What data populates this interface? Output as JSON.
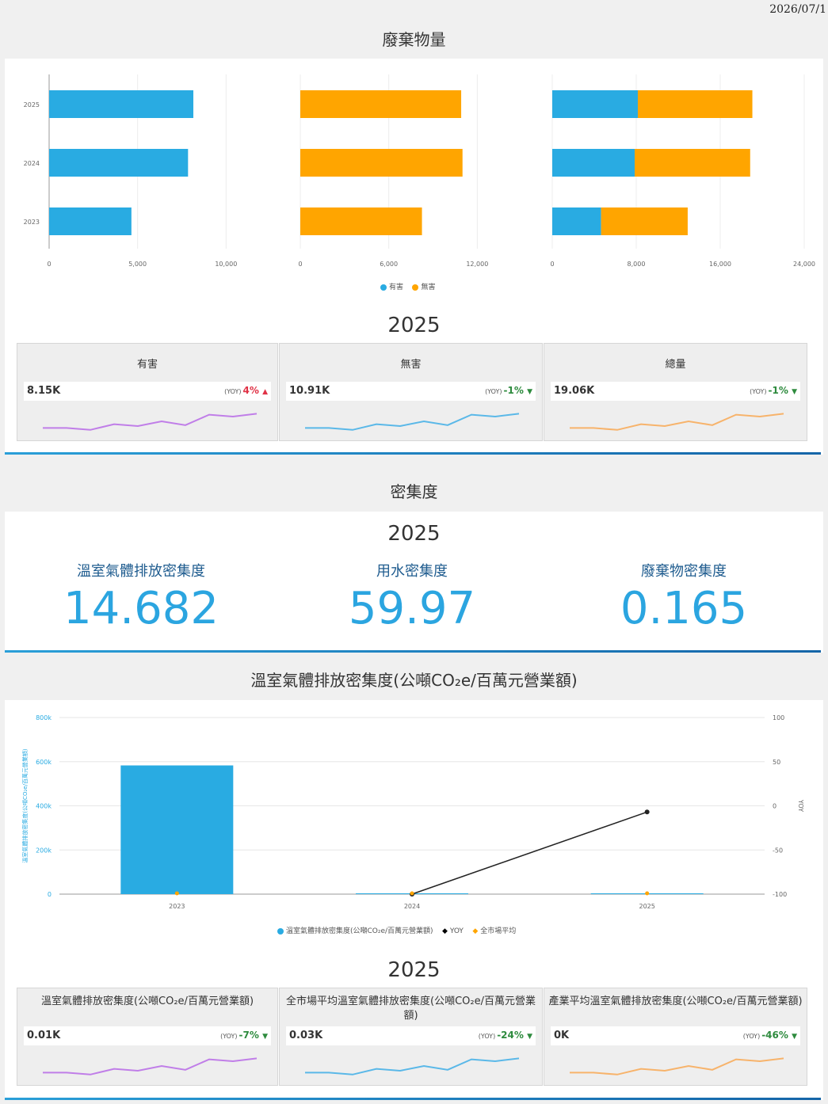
{
  "date": "2026/07/1",
  "waste_section": {
    "title": "廢棄物量",
    "colors": {
      "hazardous": "#29abe2",
      "non_hazardous": "#ffa500"
    },
    "legend": {
      "hazardous": "有害",
      "non_hazardous": "無害"
    },
    "year_heading": "2025",
    "cards": [
      {
        "title": "有害",
        "value": "8.15K",
        "yoy_label": "(YOY)",
        "yoy": "4%",
        "arrow": "▲",
        "trend": "up",
        "spark_color": "#c07ee8"
      },
      {
        "title": "無害",
        "value": "10.91K",
        "yoy_label": "(YOY)",
        "yoy": "-1%",
        "arrow": "▼",
        "trend": "down",
        "spark_color": "#5ab8e8"
      },
      {
        "title": "總量",
        "value": "19.06K",
        "yoy_label": "(YOY)",
        "yoy": "-1%",
        "arrow": "▼",
        "trend": "down",
        "spark_color": "#f7b36b"
      }
    ]
  },
  "density_section": {
    "title": "密集度",
    "year_heading": "2025",
    "kpis": [
      {
        "name": "溫室氣體排放密集度",
        "value": "14.682"
      },
      {
        "name": "用水密集度",
        "value": "59.97"
      },
      {
        "name": "廢棄物密集度",
        "value": "0.165"
      }
    ]
  },
  "ghg_section": {
    "title": "溫室氣體排放密集度(公噸CO₂e/百萬元營業額)",
    "y_axis_label": "溫室氣體排放密集度(公噸CO₂e/百萬元營業額)",
    "y2_axis_label": "YOY",
    "legend": {
      "bar": "溫室氣體排放密集度(公噸CO₂e/百萬元營業額)",
      "yoy": "YOY",
      "market": "全市場平均"
    },
    "year_heading": "2025",
    "cards": [
      {
        "title": "溫室氣體排放密集度(公噸CO₂e/百萬元營業額)",
        "value": "0.01K",
        "yoy_label": "(YOY)",
        "yoy": "-7%",
        "arrow": "▼",
        "trend": "down",
        "spark_color": "#c07ee8"
      },
      {
        "title": "全市場平均溫室氣體排放密集度(公噸CO₂e/百萬元營業額)",
        "value": "0.03K",
        "yoy_label": "(YOY)",
        "yoy": "-24%",
        "arrow": "▼",
        "trend": "down",
        "spark_color": "#5ab8e8"
      },
      {
        "title": "產業平均溫室氣體排放密集度(公噸CO₂e/百萬元營業額)",
        "value": "0K",
        "yoy_label": "(YOY)",
        "yoy": "-46%",
        "arrow": "▼",
        "trend": "down",
        "spark_color": "#f7b36b"
      }
    ]
  },
  "chart_data": [
    {
      "type": "bar",
      "orientation": "horizontal",
      "categories": [
        "2025",
        "2024",
        "2023"
      ],
      "series": [
        {
          "name": "有害",
          "values": [
            8150,
            7850,
            4650
          ]
        }
      ],
      "xlim": [
        0,
        12000
      ],
      "xticks": [
        "0",
        "5,000",
        "10,000"
      ]
    },
    {
      "type": "bar",
      "orientation": "horizontal",
      "categories": [
        "2025",
        "2024",
        "2023"
      ],
      "series": [
        {
          "name": "無害",
          "values": [
            10910,
            11000,
            8250
          ]
        }
      ],
      "xlim": [
        0,
        14400
      ],
      "xticks": [
        "0",
        "6,000",
        "12,000"
      ]
    },
    {
      "type": "bar",
      "orientation": "horizontal",
      "stacked": true,
      "categories": [
        "2025",
        "2024",
        "2023"
      ],
      "series": [
        {
          "name": "有害",
          "values": [
            8150,
            7850,
            4650
          ]
        },
        {
          "name": "無害",
          "values": [
            10910,
            11000,
            8250
          ]
        }
      ],
      "xlim": [
        0,
        24000
      ],
      "xticks": [
        "0",
        "8,000",
        "16,000",
        "24,000"
      ]
    },
    {
      "type": "bar",
      "categories": [
        "2023",
        "2024",
        "2025"
      ],
      "series": [
        {
          "name": "溫室氣體排放密集度(公噸CO₂e/百萬元營業額)",
          "values": [
            583000,
            15,
            14.682
          ]
        },
        {
          "name": "YOY",
          "type": "line",
          "axis": "right",
          "values": [
            null,
            -100,
            -7
          ]
        },
        {
          "name": "全市場平均",
          "type": "scatter",
          "values": [
            30,
            30,
            30
          ]
        }
      ],
      "ylim": [
        0,
        800000
      ],
      "yticks": [
        "0",
        "200k",
        "400k",
        "600k",
        "800k"
      ],
      "y2lim": [
        -100,
        100
      ],
      "y2ticks": [
        "-100",
        "-50",
        "0",
        "50",
        "100"
      ]
    }
  ],
  "sparkline": [
    0.15,
    0.15,
    0.05,
    0.35,
    0.25,
    0.5,
    0.3,
    0.85,
    0.75,
    0.9
  ]
}
